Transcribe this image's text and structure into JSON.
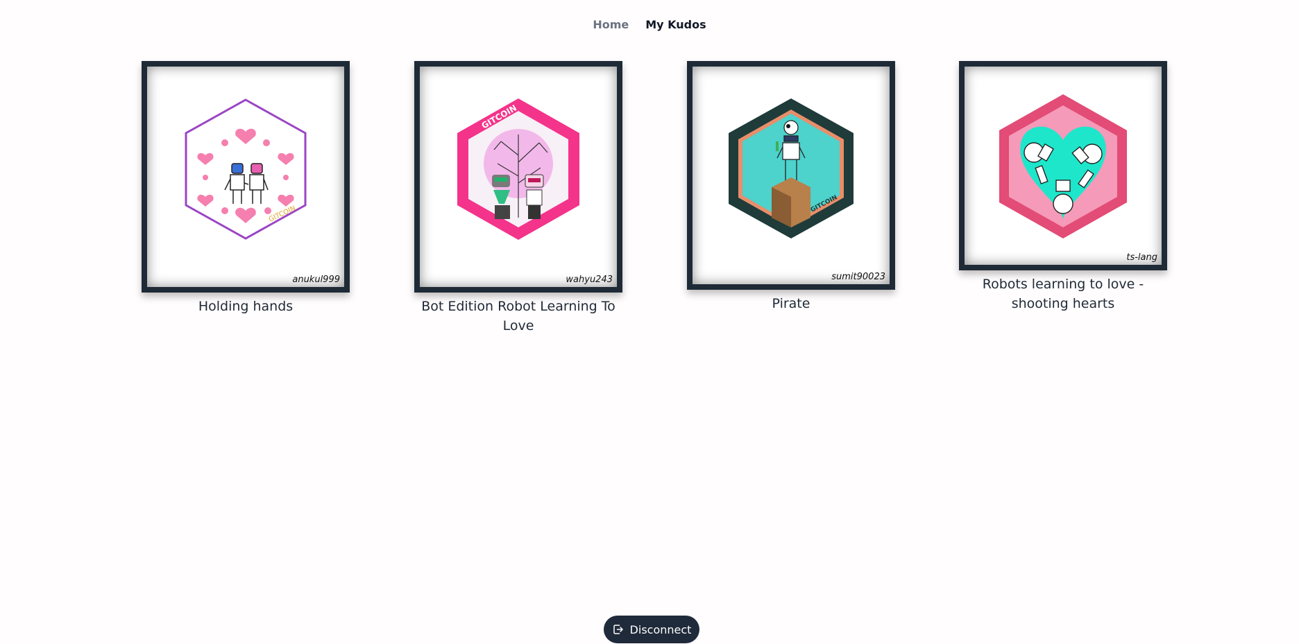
{
  "nav": {
    "home_label": "Home",
    "kudos_label": "My Kudos"
  },
  "cards": [
    {
      "title": "Holding hands",
      "owner": "anukul999",
      "badge_text": "GITCOIN"
    },
    {
      "title": "Bot Edition Robot Learning To Love",
      "owner": "wahyu243",
      "badge_text": "GITCOIN"
    },
    {
      "title": "Pirate",
      "owner": "sumit90023",
      "badge_text": "GITCOIN"
    },
    {
      "title": "Robots learning to love - shooting hearts",
      "owner": "ts-lang",
      "badge_text": ""
    }
  ],
  "disconnect": {
    "label": "Disconnect",
    "icon": "logout-icon"
  },
  "colors": {
    "frame": "#1f2a37",
    "button": "#1f2a3a"
  }
}
